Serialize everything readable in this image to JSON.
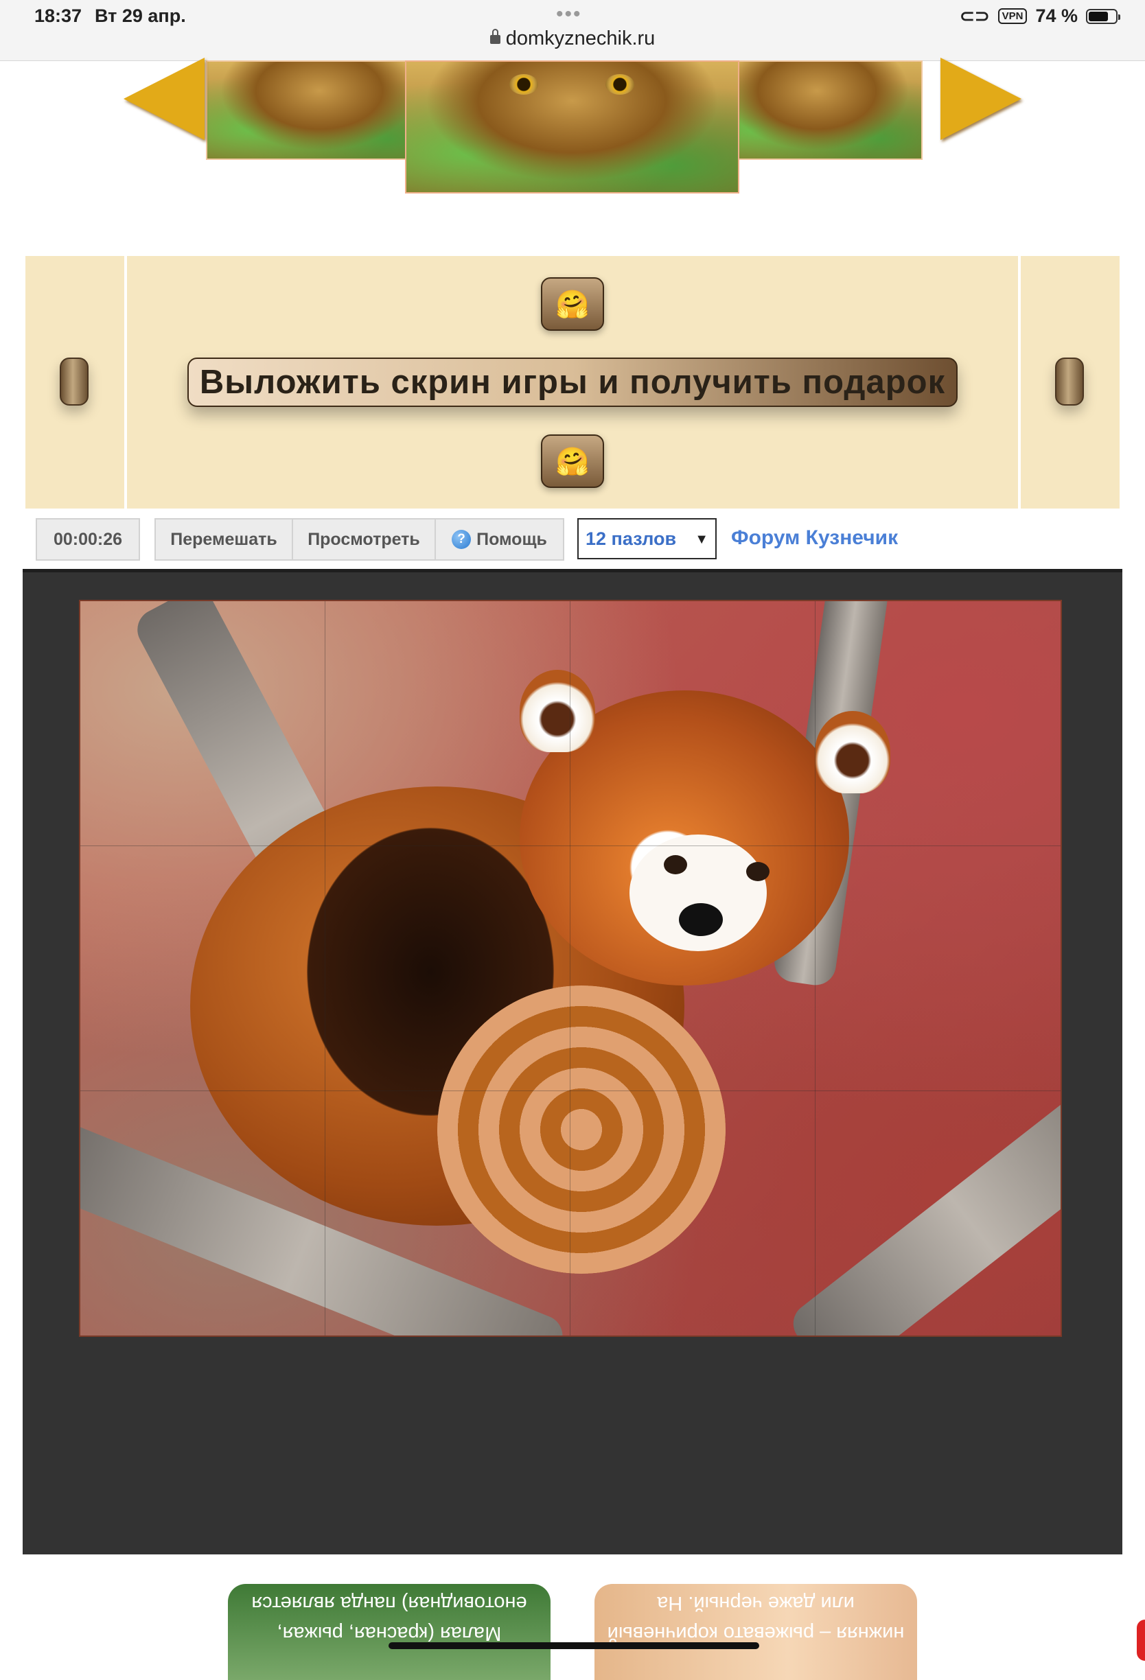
{
  "status_bar": {
    "time": "18:37",
    "date": "Вт 29 апр.",
    "dots": "•••",
    "url": "domkyznechik.ru",
    "vpn": "VPN",
    "battery_text": "74 %",
    "battery_level": 0.74
  },
  "carousel": {
    "prev_icon": "arrow-left-icon",
    "next_icon": "arrow-right-icon"
  },
  "banner": {
    "emoji_top": "🤗",
    "emoji_bottom": "🤗",
    "gift_label": "Выложить скрин игры и получить подарок"
  },
  "toolbar": {
    "timer": "00:00:26",
    "shuffle_label": "Перемешать",
    "preview_label": "Просмотреть",
    "help_icon": "?",
    "help_label": "Помощь",
    "pieces_selected": "12 пазлов",
    "caret": "▼",
    "forum_label": "Форум Кузнечик"
  },
  "cards": {
    "card1_text": "Малая (красная, рыжая, енотовидная) панда является",
    "card2_text": "нижняя – рыжевато коричневый или даже черный. На"
  },
  "colors": {
    "banner_bg": "#f6e7c1",
    "board_bg": "#333333",
    "link": "#4a7fd6"
  }
}
